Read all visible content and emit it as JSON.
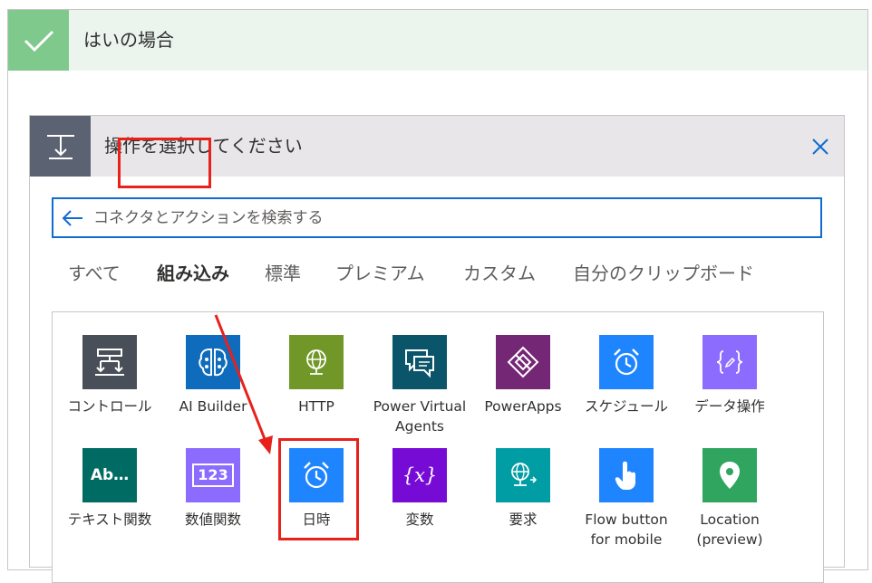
{
  "condition": {
    "title": "はいの場合",
    "accent": "#7fc98d",
    "header_bg": "#ebf5ee"
  },
  "action_picker": {
    "title": "操作を選択してください",
    "icon": "step-icon",
    "search": {
      "placeholder": "コネクタとアクションを検索する"
    },
    "tabs": [
      {
        "label": "すべて"
      },
      {
        "label": "組み込み",
        "selected": true
      },
      {
        "label": "標準"
      },
      {
        "label": "プレミアム"
      },
      {
        "label": "カスタム"
      },
      {
        "label": "自分のクリップボード"
      }
    ],
    "connectors": [
      {
        "label": "コントロール",
        "icon": "control-icon",
        "color": "#484f58"
      },
      {
        "label": "AI Builder",
        "icon": "ai-builder-icon",
        "color": "#0f6cbd"
      },
      {
        "label": "HTTP",
        "icon": "globe-icon",
        "color": "#709727"
      },
      {
        "label": "Power Virtual Agents",
        "icon": "chat-icon",
        "color": "#0b556a"
      },
      {
        "label": "PowerApps",
        "icon": "powerapps-icon",
        "color": "#742774"
      },
      {
        "label": "スケジュール",
        "icon": "alarm-clock-icon",
        "color": "#1f85ff"
      },
      {
        "label": "データ操作",
        "icon": "data-operation-icon",
        "color": "#8c6cff"
      },
      {
        "label": "テキスト関数",
        "icon": "text-functions-icon",
        "glyph": "Ab…",
        "color": "#006b62"
      },
      {
        "label": "数値関数",
        "icon": "number-functions-icon",
        "glyph": "123",
        "color": "#8c6cff"
      },
      {
        "label": "日時",
        "icon": "alarm-clock-icon",
        "color": "#1f85ff"
      },
      {
        "label": "変数",
        "icon": "variable-icon",
        "glyph": "{x}",
        "color": "#770bd6"
      },
      {
        "label": "要求",
        "icon": "request-icon",
        "color": "#009da5"
      },
      {
        "label": "Flow button for mobile",
        "icon": "touch-icon",
        "color": "#1f85ff"
      },
      {
        "label": "Location (preview)",
        "icon": "location-pin-icon",
        "color": "#2fa55f"
      }
    ]
  },
  "annotation_color": "#e8211b"
}
